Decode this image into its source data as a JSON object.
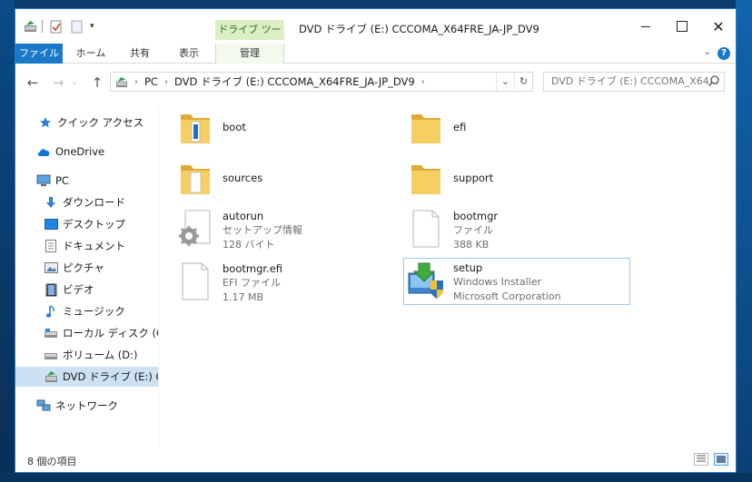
{
  "window": {
    "title": "DVD ドライブ (E:) CCCOMA_X64FRE_JA-JP_DV9",
    "contextual_tab": "ドライブ ツール"
  },
  "ribbon": {
    "tabs": [
      {
        "label": "ファイル"
      },
      {
        "label": "ホーム"
      },
      {
        "label": "共有"
      },
      {
        "label": "表示"
      },
      {
        "label": "管理"
      }
    ]
  },
  "address": {
    "crumbs": [
      "PC",
      "DVD ドライブ (E:) CCCOMA_X64FRE_JA-JP_DV9"
    ],
    "search_placeholder": "DVD ドライブ (E:) CCCOMA_X64..."
  },
  "sidebar": {
    "items": [
      {
        "label": "クイック アクセス",
        "icon": "star-icon"
      },
      {
        "label": "OneDrive",
        "icon": "cloud-icon"
      },
      {
        "label": "PC",
        "icon": "computer-icon"
      },
      {
        "label": "ダウンロード",
        "icon": "download-icon"
      },
      {
        "label": "デスクトップ",
        "icon": "desktop-icon"
      },
      {
        "label": "ドキュメント",
        "icon": "document-icon"
      },
      {
        "label": "ピクチャ",
        "icon": "pictures-icon"
      },
      {
        "label": "ビデオ",
        "icon": "video-icon"
      },
      {
        "label": "ミュージック",
        "icon": "music-icon"
      },
      {
        "label": "ローカル ディスク (C:)",
        "icon": "local-disk-icon"
      },
      {
        "label": "ボリューム (D:)",
        "icon": "volume-icon"
      },
      {
        "label": "DVD ドライブ (E:) CCC",
        "icon": "dvd-drive-icon"
      },
      {
        "label": "ネットワーク",
        "icon": "network-icon"
      }
    ]
  },
  "files": [
    {
      "name": "boot",
      "line1": "",
      "line2": "",
      "kind": "folder"
    },
    {
      "name": "efi",
      "line1": "",
      "line2": "",
      "kind": "folder"
    },
    {
      "name": "sources",
      "line1": "",
      "line2": "",
      "kind": "folder"
    },
    {
      "name": "support",
      "line1": "",
      "line2": "",
      "kind": "folder"
    },
    {
      "name": "autorun",
      "line1": "セットアップ情報",
      "line2": "128 バイト",
      "kind": "settings-file"
    },
    {
      "name": "bootmgr",
      "line1": "ファイル",
      "line2": "388 KB",
      "kind": "file"
    },
    {
      "name": "bootmgr.efi",
      "line1": "EFI ファイル",
      "line2": "1.17 MB",
      "kind": "file"
    },
    {
      "name": "setup",
      "line1": "Windows Installer",
      "line2": "Microsoft Corporation",
      "kind": "installer"
    }
  ],
  "status": {
    "item_count": "8 個の項目"
  },
  "colors": {
    "accent": "#1979ca",
    "contextual": "#daefc4",
    "selection": "#cce1f4",
    "folder": "#f3c85b"
  }
}
